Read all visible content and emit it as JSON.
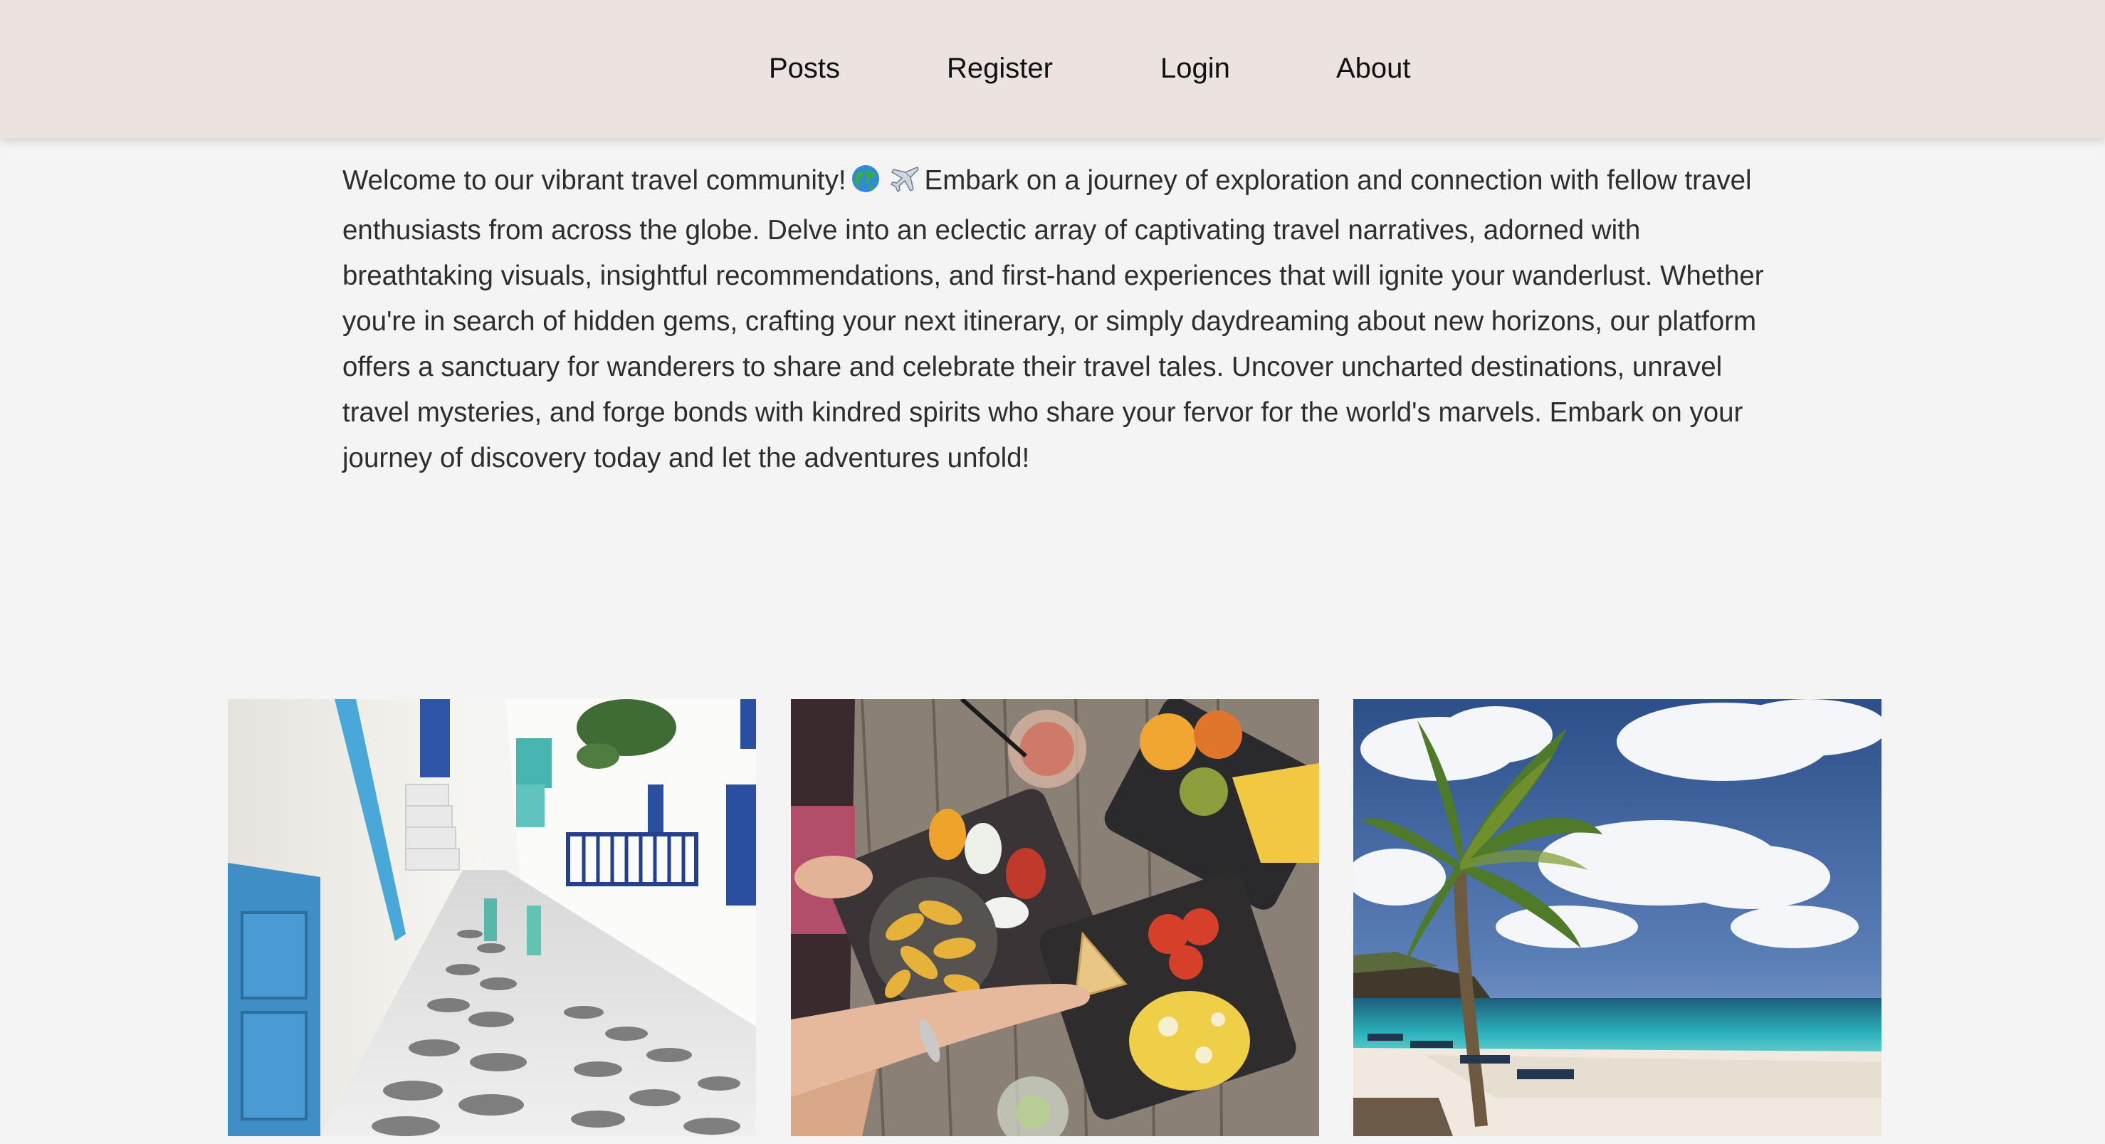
{
  "nav": {
    "links": [
      "Posts",
      "Register",
      "Login",
      "About"
    ]
  },
  "intro": {
    "lead": "Welcome to our vibrant travel community!",
    "emojis": [
      "globe-icon",
      "airplane-icon"
    ],
    "body": "Embark on a journey of exploration and connection with fellow travel enthusiasts from across the globe. Delve into an eclectic array of captivating travel narratives, adorned with breathtaking visuals, insightful recommendations, and first-hand experiences that will ignite your wanderlust. Whether you're in search of hidden gems, crafting your next itinerary, or simply daydreaming about new horizons, our platform offers a sanctuary for wanderers to share and celebrate their travel tales. Uncover uncharted destinations, unravel travel mysteries, and forge bonds with kindred spirits who share your fervor for the world's marvels. Embark on your journey of discovery today and let the adventures unfold!"
  },
  "gallery": {
    "images": [
      "whitewashed-alley-photo",
      "food-table-photo",
      "palm-beach-photo"
    ]
  },
  "colors": {
    "navbar_bg": "#ebe3df",
    "page_bg": "#f4f4f4",
    "text": "#2d2d2d"
  }
}
